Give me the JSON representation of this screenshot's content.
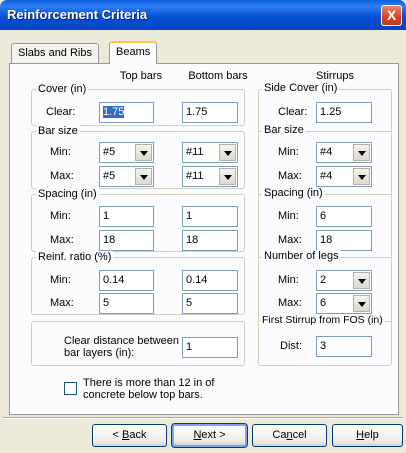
{
  "window": {
    "title": "Reinforcement Criteria",
    "close_glyph": "X"
  },
  "tabs": [
    {
      "label": "Slabs and Ribs"
    },
    {
      "label": "Beams"
    }
  ],
  "columns": {
    "top": "Top bars",
    "bottom": "Bottom bars",
    "stirrups": "Stirrups"
  },
  "cover": {
    "legend": "Cover (in)",
    "clear_label": "Clear:",
    "top_clear": "1.75",
    "bottom_clear": "1.75"
  },
  "bar_size": {
    "legend": "Bar size",
    "min_label": "Min:",
    "max_label": "Max:",
    "top_min": "#5",
    "top_max": "#5",
    "bottom_min": "#11",
    "bottom_max": "#11"
  },
  "spacing": {
    "legend": "Spacing (in)",
    "min_label": "Min:",
    "max_label": "Max:",
    "top_min": "1",
    "top_max": "18",
    "bottom_min": "1",
    "bottom_max": "18"
  },
  "reinf_ratio": {
    "legend": "Reinf. ratio (%)",
    "min_label": "Min:",
    "max_label": "Max:",
    "top_min": "0.14",
    "top_max": "5",
    "bottom_min": "0.14",
    "bottom_max": "5"
  },
  "clear_distance": {
    "label_line1": "Clear distance between",
    "label_line2": "bar layers (in):",
    "value": "1"
  },
  "stirrups": {
    "side_cover": {
      "legend": "Side Cover (in)",
      "clear_label": "Clear:",
      "value": "1.25"
    },
    "bar_size": {
      "legend": "Bar size",
      "min_label": "Min:",
      "max_label": "Max:",
      "min": "#4",
      "max": "#4"
    },
    "spacing": {
      "legend": "Spacing (in)",
      "min_label": "Min:",
      "max_label": "Max:",
      "min": "6",
      "max": "18"
    },
    "legs": {
      "legend": "Number of legs",
      "min_label": "Min:",
      "max_label": "Max:",
      "min": "2",
      "max": "6"
    },
    "first": {
      "legend": "First Stirrup from FOS (in)",
      "dist_label": "Dist:",
      "value": "3"
    }
  },
  "concrete_check": {
    "line1": "There is more than 12 in of",
    "line2": "concrete below top bars.",
    "checked": false
  },
  "buttons": {
    "back_lt": "< ",
    "back_key": "B",
    "back_rest": "ack",
    "next_key": "N",
    "next_rest": "ext >",
    "cancel_pre": "Ca",
    "cancel_key": "n",
    "cancel_rest": "cel",
    "help_key": "H",
    "help_rest": "elp"
  }
}
